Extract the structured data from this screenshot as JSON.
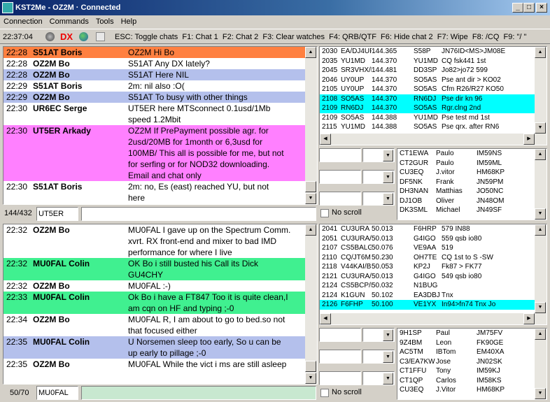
{
  "window": {
    "title": "KST2Me - OZ2M · Connected",
    "min": "_",
    "max": "□",
    "close": "×"
  },
  "menu": [
    "Connection",
    "Commands",
    "Tools",
    "Help"
  ],
  "toolbar": {
    "time": "22:37:04",
    "dx": "DX",
    "shortcuts": "ESC: Toggle chats  F1: Chat 1  F2: Chat 2  F3: Clear watches  F4: QRB/QTF  F6: Hide chat 2  F7: Wipe  F8: /CQ  F9: \"/ \""
  },
  "colors": {
    "orange": "#ff8040",
    "blue": "#b4c0ec",
    "magenta": "#ff80ff",
    "green": "#40f090",
    "cyan": "#00ffff",
    "white": "#ffffff"
  },
  "chat1": {
    "counter": "144/432",
    "target": "UT5ER",
    "message": "",
    "rows": [
      {
        "t": "22:28",
        "n": "S51AT Boris",
        "m": [
          "OZ2M Hi Bo"
        ],
        "c": "orange"
      },
      {
        "t": "22:28",
        "n": "OZ2M Bo",
        "m": [
          "S51AT Any DX lately?"
        ],
        "c": "white"
      },
      {
        "t": "22:28",
        "n": "OZ2M Bo",
        "m": [
          "S51AT Here NIL"
        ],
        "c": "blue"
      },
      {
        "t": "22:29",
        "n": "S51AT Boris",
        "m": [
          "2m: nil also :O("
        ],
        "c": "white"
      },
      {
        "t": "22:29",
        "n": "OZ2M Bo",
        "m": [
          "S51AT To busy with other things"
        ],
        "c": "blue"
      },
      {
        "t": "22:30",
        "n": "UR6EC Serge",
        "m": [
          "UT5ER here MTSconnect 0.1usd/1Mb",
          "speed 1.2Mbit"
        ],
        "c": "white"
      },
      {
        "t": "22:30",
        "n": "UT5ER Arkady",
        "m": [
          "OZ2M If PrePayment possible agr. for",
          "2usd/20MB for 1month or 6,3usd for",
          "100MB/ This all is possible for me, but not",
          "for serfing or for NOD32 downloading.",
          "Email and chat only"
        ],
        "c": "magenta"
      },
      {
        "t": "22:30",
        "n": "S51AT Boris",
        "m": [
          "2m: no, Es (east) reached YU, but not",
          "here"
        ],
        "c": "white"
      }
    ]
  },
  "chat2": {
    "counter": "50/70",
    "target": "MU0FAL",
    "message": "",
    "rows": [
      {
        "t": "22:32",
        "n": "OZ2M Bo",
        "m": [
          "MU0FAL I gave up on the Spectrum Comm.",
          "xvrt. RX front-end and mixer to bad IMD",
          "performance for where I live"
        ],
        "c": "white"
      },
      {
        "t": "22:32",
        "n": "MU0FAL Colin",
        "m": [
          "OK Bo i still busted his Call its Dick",
          "GU4CHY"
        ],
        "c": "green"
      },
      {
        "t": "22:32",
        "n": "OZ2M Bo",
        "m": [
          "MU0FAL :-)"
        ],
        "c": "white"
      },
      {
        "t": "22:33",
        "n": "MU0FAL Colin",
        "m": [
          "Ok Bo i have a FT847 Too it is quite clean,I",
          "am cqn on HF and typing ;-0"
        ],
        "c": "green"
      },
      {
        "t": "22:34",
        "n": "OZ2M Bo",
        "m": [
          "MU0FAL R, I am about to go to bed.so not",
          "that focused either"
        ],
        "c": "white"
      },
      {
        "t": "22:35",
        "n": "MU0FAL Colin",
        "m": [
          "U Norsemen sleep too early, So u can be",
          "up early to pillage ;-0"
        ],
        "c": "blue"
      },
      {
        "t": "22:35",
        "n": "OZ2M Bo",
        "m": [
          "MU0FAL While the vict i ms are still asleep"
        ],
        "c": "white"
      }
    ]
  },
  "spots1": [
    [
      "2030",
      "EA/DJ4UF",
      "144.365",
      "S58P",
      "JN76ID<MS>JM08E",
      "white"
    ],
    [
      "2035",
      "YU1MD",
      "144.370",
      "YU1MD",
      "CQ fsk441 1st",
      "white"
    ],
    [
      "2045",
      "SR3VHX/B",
      "144.481",
      "DD3SP",
      "Jo82>jo72 599",
      "white"
    ],
    [
      "2046",
      "UY0UP",
      "144.370",
      "SO5AS",
      "Pse ant dir > KO02",
      "white"
    ],
    [
      "2105",
      "UY0UP",
      "144.370",
      "SO5AS",
      "Cfm R26/R27 KO50",
      "white"
    ],
    [
      "2108",
      "SO5AS",
      "144.370",
      "RN6DJ",
      "Pse dir kn 96",
      "cyan"
    ],
    [
      "2109",
      "RN6DJ",
      "144.370",
      "SO5AS",
      "Rgr.clng 2nd",
      "cyan"
    ],
    [
      "2109",
      "SO5AS",
      "144.388",
      "YU1MD",
      "Pse test md 1st",
      "white"
    ],
    [
      "2115",
      "YU1MD",
      "144.388",
      "SO5AS",
      "Pse qrx. after RN6",
      "white"
    ]
  ],
  "users1": [
    [
      "CT1EWA",
      "Paulo",
      "IM59NS"
    ],
    [
      "CT2GUR",
      "Paulo",
      "IM59ML"
    ],
    [
      "CU3EQ",
      "J.vitor",
      "HM68KP"
    ],
    [
      "DF5NK",
      "Frank",
      "JN59PM"
    ],
    [
      "DH3NAN",
      "Matthias",
      "JO50NC"
    ],
    [
      "DJ1OB",
      "Oliver",
      "JN48OM"
    ],
    [
      "DK3SML",
      "Michael",
      "JN49SF"
    ]
  ],
  "spots2": [
    [
      "2041",
      "CU3URA",
      "50.013",
      "F6HRP",
      "579 IN88",
      "white"
    ],
    [
      "2051",
      "CU3URA/B",
      "50.013",
      "G4IGO",
      "559 qsb io80",
      "white"
    ],
    [
      "2107",
      "CS5BALG/B",
      "50.076",
      "VE9AA",
      "519",
      "white"
    ],
    [
      "2110",
      "CQ/JT6M",
      "50.230",
      "OH7TE",
      "CQ 1st to S -SW",
      "white"
    ],
    [
      "2118",
      "V44KAI/B",
      "50.053",
      "KP2J",
      "Fk87 > FK77",
      "white"
    ],
    [
      "2121",
      "CU3URA/B",
      "50.013",
      "G4IGO",
      "549 qsb io80",
      "white"
    ],
    [
      "2124",
      "CS5BCP/B",
      "50.032",
      "N1BUG",
      "",
      "white"
    ],
    [
      "2124",
      "K1GUN",
      "50.102",
      "EA3DBJ",
      "Tnx",
      "white"
    ],
    [
      "2126",
      "F6FHP",
      "50.100",
      "VE1YX",
      "In94>fn74 Tnx Jo",
      "cyan"
    ]
  ],
  "users2": [
    [
      "9H1SP",
      "Paul",
      "JM75FV"
    ],
    [
      "9Z4BM",
      "Leon",
      "FK90GE"
    ],
    [
      "AC5TM",
      "IBTom",
      "EM40XA"
    ],
    [
      "C3/EA7KW",
      "Jose",
      "JN02SK"
    ],
    [
      "CT1FFU",
      "Tony",
      "IM59KJ"
    ],
    [
      "CT1QP",
      "Carlos",
      "IM58KS"
    ],
    [
      "CU3EQ",
      "J.Vitor",
      "HM68KP"
    ]
  ],
  "noscroll": "No scroll"
}
